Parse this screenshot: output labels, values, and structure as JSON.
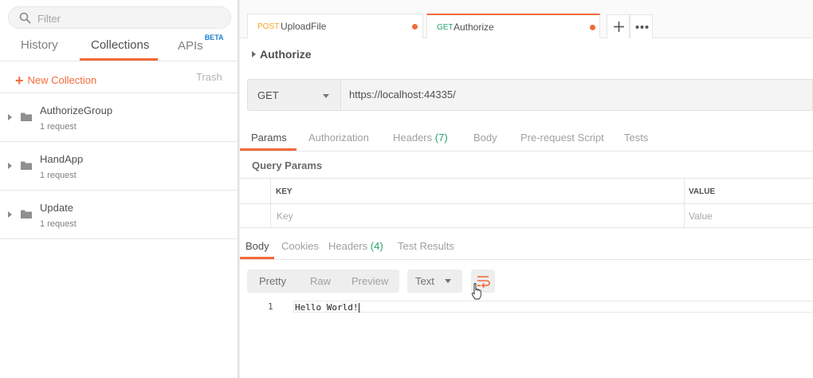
{
  "sidebar": {
    "filter_placeholder": "Filter",
    "tabs": [
      {
        "label": "History"
      },
      {
        "label": "Collections"
      },
      {
        "label": "APIs",
        "badge": "BETA"
      }
    ],
    "new_collection_label": "New Collection",
    "trash_label": "Trash",
    "collections": [
      {
        "name": "AuthorizeGroup",
        "count": "1 request"
      },
      {
        "name": "HandApp",
        "count": "1 request"
      },
      {
        "name": "Update",
        "count": "1 request"
      }
    ]
  },
  "request_tabs": [
    {
      "method": "POST",
      "name": "UploadFile",
      "method_color": "#f5a623"
    },
    {
      "method": "GET",
      "name": "Authorize",
      "method_color": "#26a26a"
    }
  ],
  "request": {
    "name": "Authorize",
    "method": "GET",
    "url": "https://localhost:44335/"
  },
  "request_sections": [
    {
      "label": "Params"
    },
    {
      "label": "Authorization"
    },
    {
      "label": "Headers",
      "count": "(7)"
    },
    {
      "label": "Body"
    },
    {
      "label": "Pre-request Script"
    },
    {
      "label": "Tests"
    }
  ],
  "query_params": {
    "title": "Query Params",
    "key_header": "KEY",
    "value_header": "VALUE",
    "key_placeholder": "Key",
    "value_placeholder": "Value"
  },
  "response_sections": [
    {
      "label": "Body"
    },
    {
      "label": "Cookies"
    },
    {
      "label": "Headers",
      "count": "(4)"
    },
    {
      "label": "Test Results"
    }
  ],
  "response_view": {
    "modes": [
      "Pretty",
      "Raw",
      "Preview"
    ],
    "format": "Text"
  },
  "response_body": {
    "line_number": "1",
    "text": "Hello World!"
  },
  "colors": {
    "accent": "#f26b3a",
    "count_green": "#26a26a",
    "beta_blue": "#1c7fd0"
  }
}
